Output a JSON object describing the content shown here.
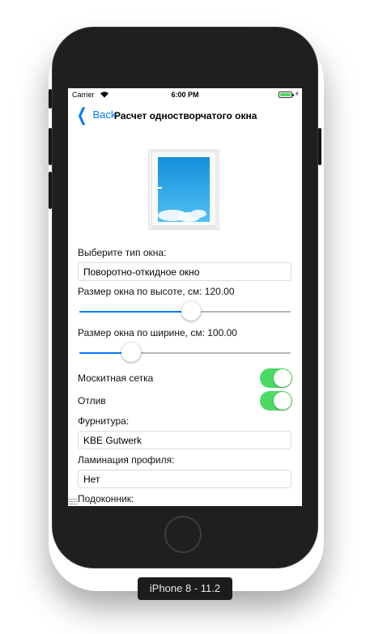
{
  "status_bar": {
    "carrier": "Carrier",
    "time": "6:00 PM"
  },
  "nav": {
    "back_label": "Back",
    "title": "Расчет одностворчатого окна"
  },
  "form": {
    "window_type_label": "Выберите тип окна:",
    "window_type_value": "Поворотно-откидное окно",
    "height_label": "Размер окна по высоте, см: 120.00",
    "height_slider_fraction": 0.53,
    "width_label": "Размер окна по ширине, см: 100.00",
    "width_slider_fraction": 0.22,
    "mosquito_label": "Москитная сетка",
    "mosquito_on": true,
    "drip_label": "Отлив",
    "drip_on": true,
    "fittings_label": "Фурнитура:",
    "fittings_value": "KBE Gutwerk",
    "lamination_label": "Ламинация профиля:",
    "lamination_value": "Нет",
    "sill_label": "Подоконник:"
  },
  "device_label": "iPhone 8 - 11.2",
  "colors": {
    "accent": "#007aff",
    "switch_on": "#4cd964",
    "sky": "#1e9be3"
  }
}
